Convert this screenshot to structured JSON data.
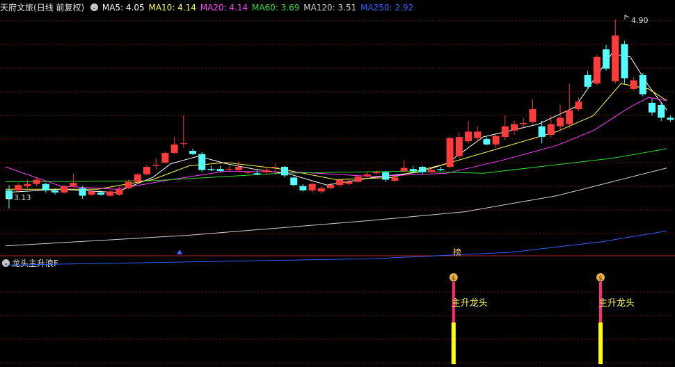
{
  "stock": {
    "title": "天府文旅",
    "mode": "(日线 前复权)"
  },
  "ma_legend": [
    {
      "label": "MA5: 4.05",
      "color": "#ffffff"
    },
    {
      "label": "MA10: 4.14",
      "color": "#ffff4d"
    },
    {
      "label": "MA20: 4.14",
      "color": "#ff40ff"
    },
    {
      "label": "MA60: 3.69",
      "color": "#33dd33"
    },
    {
      "label": "MA120: 3.51",
      "color": "#d0d0d0"
    },
    {
      "label": "MA250: 2.92",
      "color": "#3060ff"
    }
  ],
  "indicator": {
    "name": "龙头主升浪F",
    "signal_text": "主升龙头",
    "marker_text": "榜"
  },
  "chart_data": {
    "type": "candlestick",
    "high_label": "4.90",
    "low_label": "3.13",
    "ylim": [
      3.0,
      5.0
    ],
    "candles": [
      [
        3.3,
        3.22,
        3.35,
        3.13
      ],
      [
        3.3,
        3.35,
        3.37,
        3.28
      ],
      [
        3.34,
        3.36,
        3.4,
        3.32
      ],
      [
        3.36,
        3.4,
        3.42,
        3.34
      ],
      [
        3.36,
        3.3,
        3.37,
        3.28
      ],
      [
        3.3,
        3.28,
        3.32,
        3.26
      ],
      [
        3.28,
        3.34,
        3.35,
        3.27
      ],
      [
        3.34,
        3.37,
        3.46,
        3.33
      ],
      [
        3.32,
        3.25,
        3.34,
        3.22
      ],
      [
        3.26,
        3.29,
        3.3,
        3.25
      ],
      [
        3.28,
        3.26,
        3.3,
        3.25
      ],
      [
        3.25,
        3.29,
        3.3,
        3.24
      ],
      [
        3.26,
        3.31,
        3.33,
        3.25
      ],
      [
        3.32,
        3.38,
        3.4,
        3.31
      ],
      [
        3.38,
        3.45,
        3.46,
        3.36
      ],
      [
        3.45,
        3.52,
        3.54,
        3.44
      ],
      [
        3.53,
        3.54,
        3.6,
        3.5
      ],
      [
        3.56,
        3.65,
        3.66,
        3.55
      ],
      [
        3.65,
        3.73,
        3.8,
        3.64
      ],
      [
        3.74,
        3.74,
        4.0,
        3.7
      ],
      [
        3.67,
        3.64,
        3.69,
        3.63
      ],
      [
        3.64,
        3.49,
        3.66,
        3.47
      ],
      [
        3.5,
        3.49,
        3.53,
        3.48
      ],
      [
        3.5,
        3.48,
        3.53,
        3.47
      ],
      [
        3.5,
        3.5,
        3.53,
        3.48
      ],
      [
        3.49,
        3.52,
        3.57,
        3.47
      ],
      [
        3.47,
        3.47,
        3.48,
        3.45
      ],
      [
        3.46,
        3.45,
        3.5,
        3.44
      ],
      [
        3.47,
        3.49,
        3.52,
        3.45
      ],
      [
        3.52,
        3.52,
        3.55,
        3.45
      ],
      [
        3.52,
        3.44,
        3.53,
        3.42
      ],
      [
        3.42,
        3.35,
        3.43,
        3.34
      ],
      [
        3.34,
        3.3,
        3.36,
        3.29
      ],
      [
        3.3,
        3.36,
        3.37,
        3.28
      ],
      [
        3.29,
        3.32,
        3.34,
        3.27
      ],
      [
        3.32,
        3.35,
        3.37,
        3.31
      ],
      [
        3.35,
        3.4,
        3.41,
        3.33
      ],
      [
        3.36,
        3.38,
        3.4,
        3.35
      ],
      [
        3.38,
        3.43,
        3.44,
        3.37
      ],
      [
        3.43,
        3.45,
        3.47,
        3.42
      ],
      [
        3.46,
        3.47,
        3.49,
        3.45
      ],
      [
        3.47,
        3.4,
        3.48,
        3.38
      ],
      [
        3.39,
        3.42,
        3.44,
        3.38
      ],
      [
        3.48,
        3.51,
        3.58,
        3.47
      ],
      [
        3.5,
        3.48,
        3.53,
        3.47
      ],
      [
        3.52,
        3.47,
        3.53,
        3.45
      ],
      [
        3.47,
        3.49,
        3.51,
        3.46
      ],
      [
        3.5,
        3.49,
        3.52,
        3.48
      ],
      [
        3.52,
        3.79,
        3.8,
        3.51
      ],
      [
        3.62,
        3.8,
        3.84,
        3.6
      ],
      [
        3.76,
        3.85,
        3.95,
        3.74
      ],
      [
        3.79,
        3.85,
        3.9,
        3.76
      ],
      [
        3.78,
        3.73,
        3.8,
        3.72
      ],
      [
        3.73,
        3.81,
        3.82,
        3.7
      ],
      [
        3.8,
        3.9,
        4.0,
        3.77
      ],
      [
        3.86,
        3.92,
        3.95,
        3.82
      ],
      [
        3.92,
        3.93,
        3.98,
        3.88
      ],
      [
        3.94,
        4.06,
        4.15,
        3.92
      ],
      [
        3.9,
        3.8,
        3.95,
        3.74
      ],
      [
        3.82,
        3.92,
        4.0,
        3.8
      ],
      [
        3.9,
        3.98,
        4.1,
        3.85
      ],
      [
        3.92,
        4.05,
        4.3,
        3.88
      ],
      [
        4.06,
        4.13,
        4.17,
        4.04
      ],
      [
        4.38,
        4.27,
        4.42,
        4.25
      ],
      [
        4.3,
        4.55,
        4.57,
        4.28
      ],
      [
        4.62,
        4.44,
        4.66,
        4.42
      ],
      [
        4.32,
        4.75,
        4.9,
        4.3
      ],
      [
        4.67,
        4.35,
        4.7,
        4.3
      ],
      [
        4.25,
        4.33,
        4.36,
        4.24
      ],
      [
        4.38,
        4.2,
        4.4,
        4.18
      ],
      [
        4.12,
        4.03,
        4.16,
        4.0
      ],
      [
        4.1,
        3.98,
        4.12,
        3.95
      ],
      [
        3.98,
        3.96,
        4.0,
        3.94
      ]
    ],
    "ma_lines": {
      "ma5": [
        [
          0,
          3.28
        ],
        [
          6,
          3.31
        ],
        [
          12,
          3.28
        ],
        [
          16,
          3.42
        ],
        [
          18,
          3.55
        ],
        [
          21,
          3.62
        ],
        [
          24,
          3.55
        ],
        [
          27,
          3.5
        ],
        [
          31,
          3.45
        ],
        [
          35,
          3.35
        ],
        [
          40,
          3.42
        ],
        [
          45,
          3.47
        ],
        [
          48,
          3.55
        ],
        [
          52,
          3.8
        ],
        [
          58,
          3.92
        ],
        [
          62,
          4.08
        ],
        [
          66,
          4.58
        ],
        [
          68,
          4.55
        ],
        [
          70,
          4.28
        ],
        [
          72,
          4.05
        ]
      ],
      "ma10": [
        [
          0,
          3.31
        ],
        [
          10,
          3.31
        ],
        [
          16,
          3.4
        ],
        [
          20,
          3.53
        ],
        [
          24,
          3.56
        ],
        [
          30,
          3.5
        ],
        [
          36,
          3.4
        ],
        [
          42,
          3.42
        ],
        [
          48,
          3.55
        ],
        [
          54,
          3.7
        ],
        [
          60,
          3.85
        ],
        [
          64,
          4.0
        ],
        [
          67,
          4.3
        ],
        [
          70,
          4.25
        ],
        [
          72,
          4.14
        ]
      ],
      "ma20": [
        [
          0,
          3.52
        ],
        [
          6,
          3.34
        ],
        [
          12,
          3.31
        ],
        [
          18,
          3.4
        ],
        [
          24,
          3.48
        ],
        [
          32,
          3.47
        ],
        [
          40,
          3.43
        ],
        [
          48,
          3.46
        ],
        [
          54,
          3.58
        ],
        [
          60,
          3.72
        ],
        [
          64,
          3.86
        ],
        [
          68,
          4.08
        ],
        [
          70,
          4.17
        ],
        [
          72,
          4.14
        ]
      ],
      "ma60": [
        [
          0,
          3.38
        ],
        [
          16,
          3.39
        ],
        [
          30,
          3.46
        ],
        [
          44,
          3.48
        ],
        [
          52,
          3.46
        ],
        [
          60,
          3.54
        ],
        [
          66,
          3.6
        ],
        [
          72,
          3.69
        ]
      ],
      "ma120": [
        [
          0,
          2.78
        ],
        [
          10,
          2.83
        ],
        [
          20,
          2.88
        ],
        [
          30,
          2.95
        ],
        [
          40,
          3.02
        ],
        [
          50,
          3.1
        ],
        [
          60,
          3.25
        ],
        [
          66,
          3.38
        ],
        [
          72,
          3.51
        ]
      ],
      "ma250": [
        [
          0,
          2.6
        ],
        [
          20,
          2.63
        ],
        [
          40,
          2.66
        ],
        [
          55,
          2.72
        ],
        [
          65,
          2.82
        ],
        [
          72,
          2.92
        ]
      ]
    },
    "signals": [
      49,
      65
    ]
  }
}
